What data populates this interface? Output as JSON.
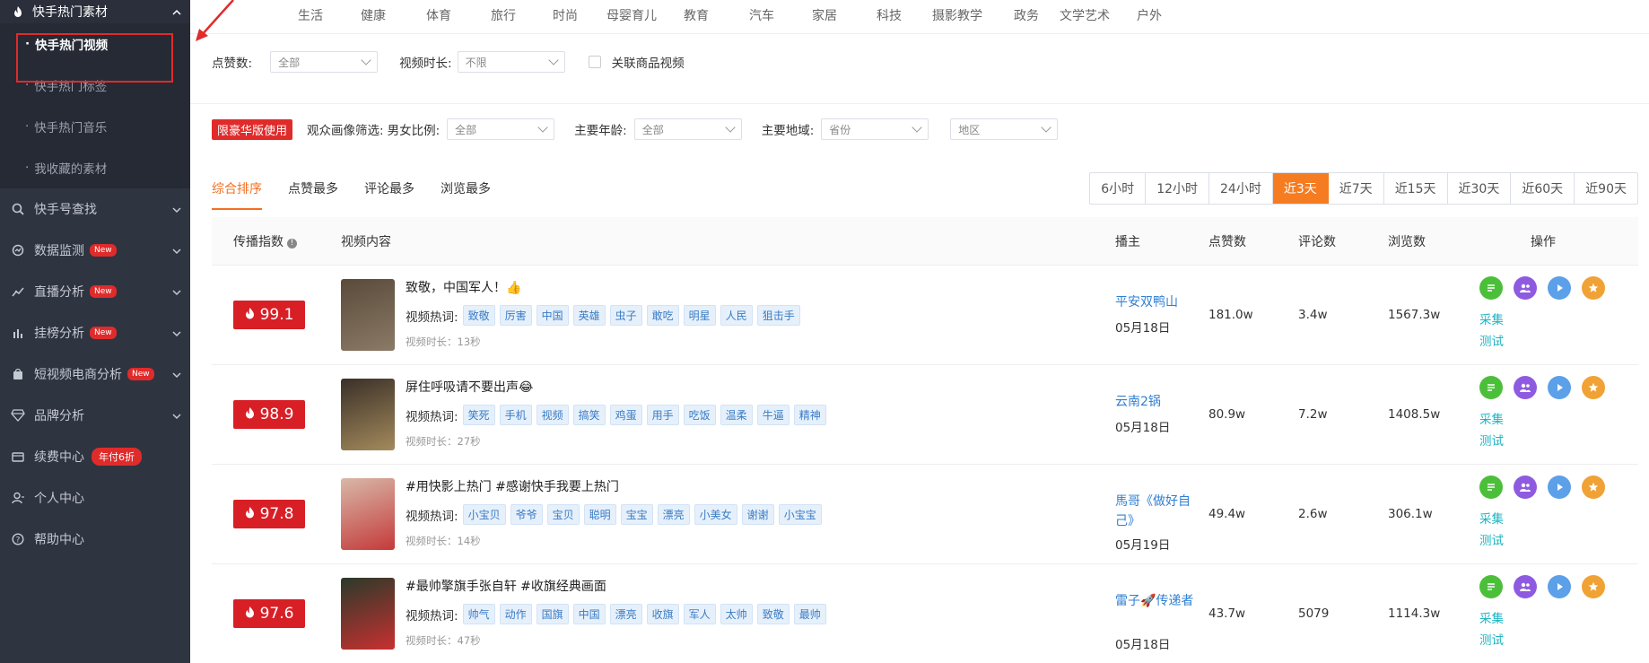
{
  "sidebar": {
    "header": "快手热门素材",
    "sub_items": [
      {
        "label": "快手热门视频",
        "active": true
      },
      {
        "label": "快手热门标签",
        "active": false
      },
      {
        "label": "快手热门音乐",
        "active": false
      },
      {
        "label": "我收藏的素材",
        "active": false
      }
    ],
    "items": [
      {
        "label": "快手号查找",
        "icon": "search-icon",
        "badge": ""
      },
      {
        "label": "数据监测",
        "icon": "monitor-icon",
        "badge": "New"
      },
      {
        "label": "直播分析",
        "icon": "live-icon",
        "badge": "New"
      },
      {
        "label": "挂榜分析",
        "icon": "bar-chart-icon",
        "badge": "New"
      },
      {
        "label": "短视频电商分析",
        "icon": "shopping-bag-icon",
        "badge": "New"
      },
      {
        "label": "品牌分析",
        "icon": "diamond-icon",
        "badge": ""
      },
      {
        "label": "续费中心",
        "icon": "wallet-icon",
        "badge": "年付6折"
      },
      {
        "label": "个人中心",
        "icon": "user-icon",
        "badge": ""
      },
      {
        "label": "帮助中心",
        "icon": "help-icon",
        "badge": ""
      }
    ]
  },
  "categories": [
    "生活",
    "健康",
    "体育",
    "旅行",
    "时尚",
    "母婴育儿",
    "教育",
    "汽车",
    "家居",
    "科技",
    "摄影教学",
    "政务",
    "文学艺术",
    "户外"
  ],
  "filters": {
    "likes_label": "点赞数:",
    "likes_value": "全部",
    "duration_label": "视频时长:",
    "duration_value": "不限",
    "product_label": "关联商品视频",
    "vip_badge": "限豪华版使用",
    "audience_label": "观众画像筛选:",
    "gender_label": "男女比例:",
    "gender_value": "全部",
    "age_label": "主要年龄:",
    "age_value": "全部",
    "region_label": "主要地域:",
    "province_placeholder": "省份",
    "area_placeholder": "地区"
  },
  "sort_tabs": [
    {
      "label": "综合排序",
      "active": true
    },
    {
      "label": "点赞最多",
      "active": false
    },
    {
      "label": "评论最多",
      "active": false
    },
    {
      "label": "浏览最多",
      "active": false
    }
  ],
  "time_ranges": [
    {
      "label": "6小时",
      "active": false
    },
    {
      "label": "12小时",
      "active": false
    },
    {
      "label": "24小时",
      "active": false
    },
    {
      "label": "近3天",
      "active": true
    },
    {
      "label": "近7天",
      "active": false
    },
    {
      "label": "近15天",
      "active": false
    },
    {
      "label": "近30天",
      "active": false
    },
    {
      "label": "近60天",
      "active": false
    },
    {
      "label": "近90天",
      "active": false
    }
  ],
  "table": {
    "headers": {
      "index": "传播指数",
      "content": "视频内容",
      "author": "播主",
      "likes": "点赞数",
      "comments": "评论数",
      "views": "浏览数",
      "ops": "操作"
    },
    "hot_label": "视频热词:",
    "op_collect": "采集",
    "op_test": "测试",
    "rows": [
      {
        "score": "99.1",
        "title": "致敬，中国军人！👍",
        "tags": [
          "致敬",
          "厉害",
          "中国",
          "英雄",
          "虫子",
          "敢吃",
          "明星",
          "人民",
          "狙击手"
        ],
        "duration": "视频时长：13秒",
        "author": "平安双鸭山",
        "date": "05月18日",
        "likes": "181.0w",
        "comments": "3.4w",
        "views": "1567.3w",
        "thumb_colors": [
          "#5a4a3a",
          "#8b7a66"
        ]
      },
      {
        "score": "98.9",
        "title": "屏住呼吸请不要出声😂",
        "tags": [
          "笑死",
          "手机",
          "视频",
          "搞笑",
          "鸡蛋",
          "用手",
          "吃饭",
          "温柔",
          "牛逼",
          "精神"
        ],
        "duration": "视频时长：27秒",
        "author": "云南2锅",
        "date": "05月18日",
        "likes": "80.9w",
        "comments": "7.2w",
        "views": "1408.5w",
        "thumb_colors": [
          "#3a3028",
          "#a48a5c"
        ]
      },
      {
        "score": "97.8",
        "title": "#用快影上热门 #感谢快手我要上热门",
        "tags": [
          "小宝贝",
          "爷爷",
          "宝贝",
          "聪明",
          "宝宝",
          "漂亮",
          "小美女",
          "谢谢",
          "小宝宝"
        ],
        "duration": "视频时长：14秒",
        "author": "馬哥《做好自己》",
        "date": "05月19日",
        "likes": "49.4w",
        "comments": "2.6w",
        "views": "306.1w",
        "thumb_colors": [
          "#d8b8a8",
          "#c43a3a"
        ]
      },
      {
        "score": "97.6",
        "title": "#最帅擎旗手张自轩 #收旗经典画面",
        "tags": [
          "帅气",
          "动作",
          "国旗",
          "中国",
          "漂亮",
          "收旗",
          "军人",
          "太帅",
          "致敬",
          "最帅"
        ],
        "duration": "视频时长：47秒",
        "author": "雷子🚀传递者",
        "date": "05月18日",
        "likes": "43.7w",
        "comments": "5079",
        "views": "1114.3w",
        "thumb_colors": [
          "#2a3a2a",
          "#c83030"
        ]
      }
    ]
  }
}
